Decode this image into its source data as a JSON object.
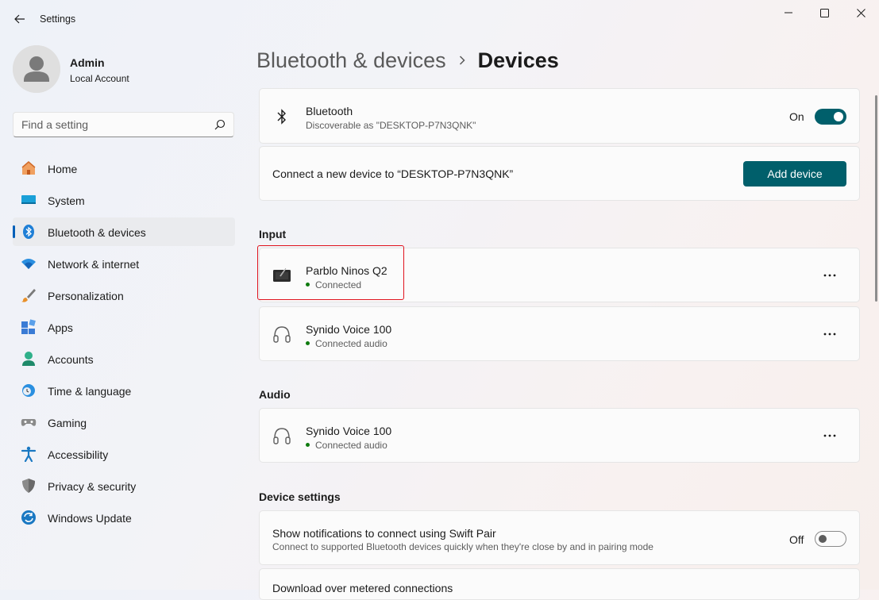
{
  "window": {
    "title": "Settings"
  },
  "profile": {
    "name": "Admin",
    "account_type": "Local Account"
  },
  "search": {
    "placeholder": "Find a setting"
  },
  "nav": [
    {
      "label": "Home",
      "icon": "home-icon",
      "active": false
    },
    {
      "label": "System",
      "icon": "system-icon",
      "active": false
    },
    {
      "label": "Bluetooth & devices",
      "icon": "bluetooth-icon",
      "active": true
    },
    {
      "label": "Network & internet",
      "icon": "wifi-icon",
      "active": false
    },
    {
      "label": "Personalization",
      "icon": "brush-icon",
      "active": false
    },
    {
      "label": "Apps",
      "icon": "apps-icon",
      "active": false
    },
    {
      "label": "Accounts",
      "icon": "accounts-icon",
      "active": false
    },
    {
      "label": "Time & language",
      "icon": "clock-globe-icon",
      "active": false
    },
    {
      "label": "Gaming",
      "icon": "gamepad-icon",
      "active": false
    },
    {
      "label": "Accessibility",
      "icon": "accessibility-icon",
      "active": false
    },
    {
      "label": "Privacy & security",
      "icon": "shield-icon",
      "active": false
    },
    {
      "label": "Windows Update",
      "icon": "update-icon",
      "active": false
    }
  ],
  "breadcrumb": {
    "parent": "Bluetooth & devices",
    "current": "Devices"
  },
  "bluetooth": {
    "title": "Bluetooth",
    "subtitle": "Discoverable as \"DESKTOP-P7N3QNK\"",
    "state_label": "On",
    "enabled": true
  },
  "connect": {
    "text": "Connect a new device to “DESKTOP-P7N3QNK”",
    "button_label": "Add device"
  },
  "sections": {
    "input": "Input",
    "audio": "Audio",
    "device_settings": "Device settings"
  },
  "input_devices": [
    {
      "name": "Parblo Ninos Q2",
      "status": "Connected",
      "icon": "drawing-tablet-icon"
    },
    {
      "name": "Synido Voice 100",
      "status": "Connected audio",
      "icon": "headphones-icon"
    }
  ],
  "audio_devices": [
    {
      "name": "Synido Voice 100",
      "status": "Connected audio",
      "icon": "headphones-icon"
    }
  ],
  "swift_pair": {
    "title": "Show notifications to connect using Swift Pair",
    "subtitle": "Connect to supported Bluetooth devices quickly when they're close by and in pairing mode",
    "state_label": "Off",
    "enabled": false
  },
  "metered": {
    "title": "Download over metered connections"
  },
  "colors": {
    "accent": "#005f6b",
    "active_indicator": "#005fb8",
    "connected_dot": "#0f7b0f",
    "highlight_box": "#e0141e"
  }
}
